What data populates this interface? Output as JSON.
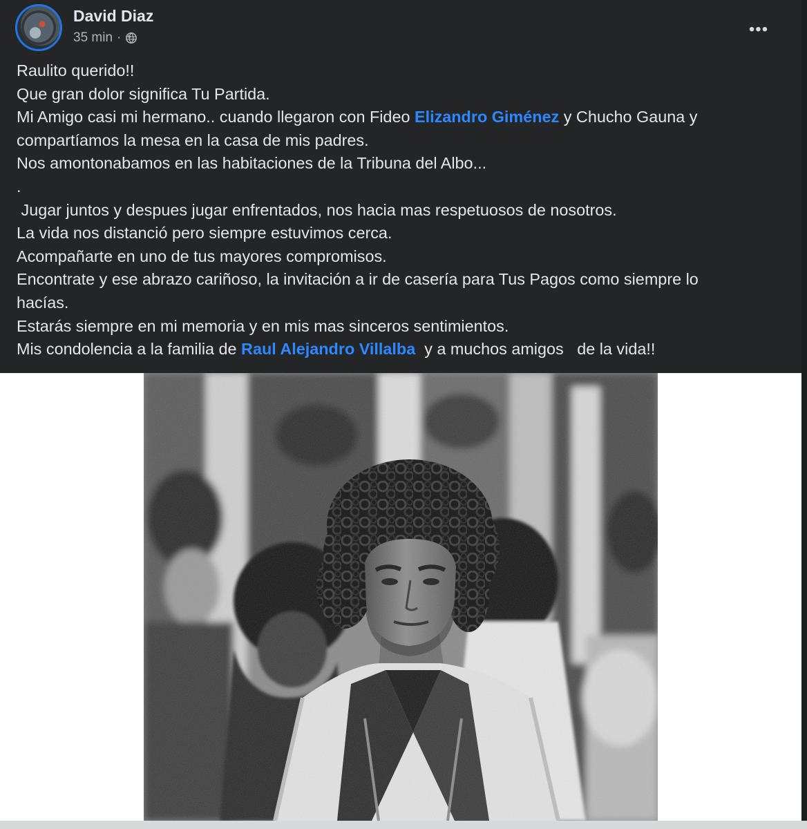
{
  "post": {
    "author": "David Diaz",
    "time": "35 min",
    "separator": "·",
    "more": "•••",
    "lines": [
      "Raulito querido!!",
      "Que gran dolor significa Tu Partida.",
      {
        "before": "Mi Amigo casi mi hermano.. cuando llegaron con Fideo ",
        "mention": "Elizandro Giménez",
        "after": " y Chucho Gauna y"
      },
      "compartíamos la mesa en la casa de mis padres.",
      "Nos amontonabamos en las habitaciones de la Tribuna del Albo...",
      ".",
      " Jugar juntos y despues jugar enfrentados, nos hacia mas respetuosos de nosotros.",
      "La vida nos distanció pero siempre estuvimos cerca.",
      "Acompañarte en uno de tus mayores compromisos.",
      "Encontrate y ese abrazo cariñoso, la invitación a ir de casería para Tus Pagos como siempre lo",
      "hacías.",
      "Estarás siempre en mi memoria y en mis mas sinceros sentimientos.",
      {
        "before": "Mis condolencia a la familia de ",
        "mention": "Raul Alejandro Villalba",
        "after": "  y a muchos amigos   de la vida!!"
      }
    ]
  },
  "colors": {
    "background": "#242526",
    "text": "#e4e6eb",
    "meta": "#b0b3b8",
    "mention": "#2d88ff",
    "avatar_ring": "#2374e1"
  },
  "icons": {
    "privacy": "globe-icon",
    "menu": "more-horizontal-icon"
  }
}
